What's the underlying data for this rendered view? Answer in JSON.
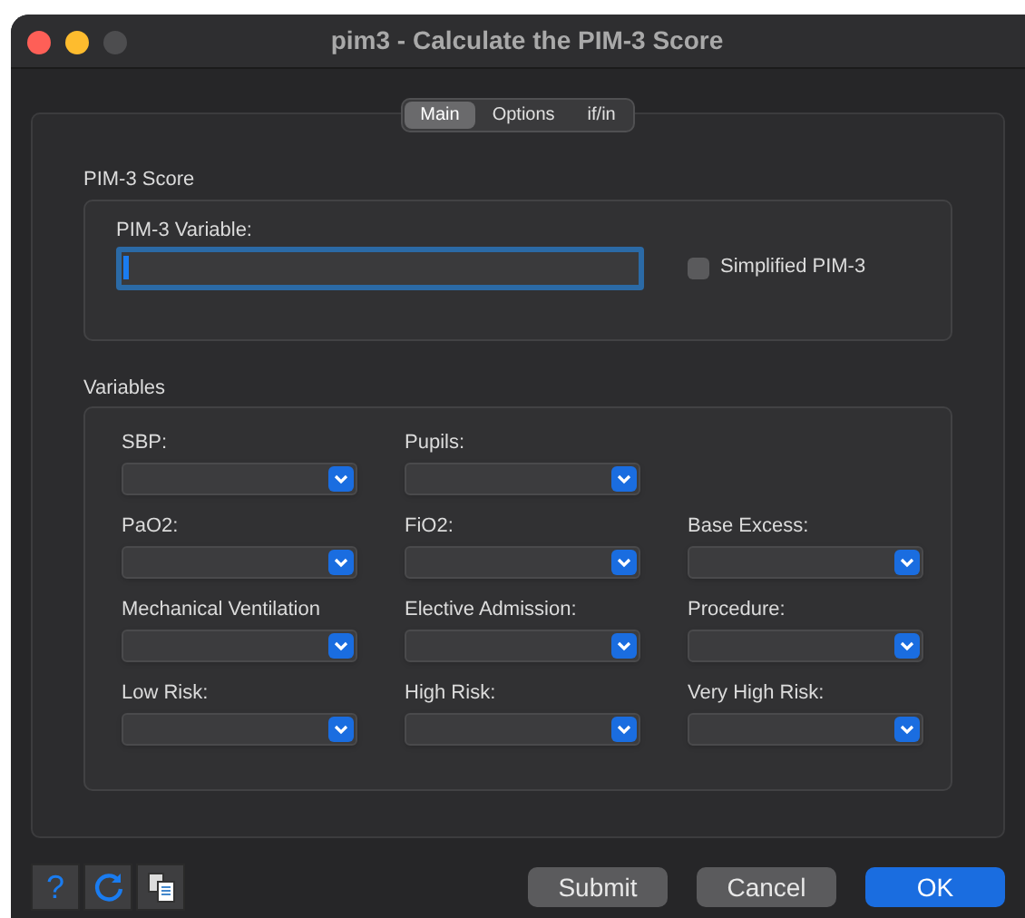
{
  "window": {
    "title": "pim3 - Calculate the PIM-3 Score"
  },
  "tabs": [
    {
      "label": "Main",
      "selected": true
    },
    {
      "label": "Options",
      "selected": false
    },
    {
      "label": "if/in",
      "selected": false
    }
  ],
  "score_group": {
    "title": "PIM-3 Score",
    "variable_label": "PIM-3 Variable:",
    "simplified": {
      "label": "Simplified PIM-3",
      "checked": false
    }
  },
  "variables_group": {
    "title": "Variables",
    "rows": [
      [
        {
          "label": "SBP:"
        },
        {
          "label": "Pupils:"
        }
      ],
      [
        {
          "label": "PaO2:"
        },
        {
          "label": "FiO2:"
        },
        {
          "label": "Base Excess:"
        }
      ],
      [
        {
          "label": "Mechanical Ventilation"
        },
        {
          "label": "Elective Admission:"
        },
        {
          "label": "Procedure:"
        }
      ],
      [
        {
          "label": "Low Risk:"
        },
        {
          "label": "High Risk:"
        },
        {
          "label": "Very High Risk:"
        }
      ]
    ]
  },
  "toolbar": [
    {
      "kind": "help",
      "label": "?"
    },
    {
      "kind": "reset"
    },
    {
      "kind": "copy"
    }
  ],
  "buttons": [
    {
      "label": "Submit",
      "kind": "normal"
    },
    {
      "label": "Cancel",
      "kind": "normal"
    },
    {
      "label": "OK",
      "kind": "default"
    }
  ]
}
